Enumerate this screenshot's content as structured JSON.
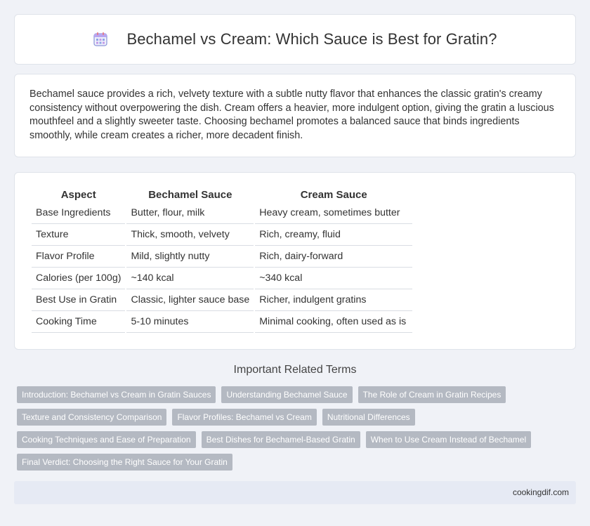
{
  "header": {
    "icon": "calendar-icon",
    "title": "Bechamel vs Cream: Which Sauce is Best for Gratin?"
  },
  "intro": {
    "text": "Bechamel sauce provides a rich, velvety texture with a subtle nutty flavor that enhances the classic gratin's creamy consistency without overpowering the dish. Cream offers a heavier, more indulgent option, giving the gratin a luscious mouthfeel and a slightly sweeter taste. Choosing bechamel promotes a balanced sauce that binds ingredients smoothly, while cream creates a richer, more decadent finish."
  },
  "table": {
    "headers": [
      "Aspect",
      "Bechamel Sauce",
      "Cream Sauce"
    ],
    "rows": [
      [
        "Base Ingredients",
        "Butter, flour, milk",
        "Heavy cream, sometimes butter"
      ],
      [
        "Texture",
        "Thick, smooth, velvety",
        "Rich, creamy, fluid"
      ],
      [
        "Flavor Profile",
        "Mild, slightly nutty",
        "Rich, dairy-forward"
      ],
      [
        "Calories (per 100g)",
        "~140 kcal",
        "~340 kcal"
      ],
      [
        "Best Use in Gratin",
        "Classic, lighter sauce base",
        "Richer, indulgent gratins"
      ],
      [
        "Cooking Time",
        "5-10 minutes",
        "Minimal cooking, often used as is"
      ]
    ]
  },
  "related": {
    "title": "Important Related Terms",
    "tags": [
      [
        "Introduction: Bechamel vs Cream in Gratin Sauces",
        "Understanding Bechamel Sauce",
        "The Role of Cream in Gratin Recipes"
      ],
      [
        "Texture and Consistency Comparison",
        "Flavor Profiles: Bechamel vs Cream",
        "Nutritional Differences"
      ],
      [
        "Cooking Techniques and Ease of Preparation",
        "Best Dishes for Bechamel-Based Gratin",
        "When to Use Cream Instead of Bechamel"
      ],
      [
        "Final Verdict: Choosing the Right Sauce for Your Gratin"
      ]
    ]
  },
  "footer": {
    "site": "cookingdif.com"
  },
  "colors": {
    "background": "#f0f2f7",
    "tag_bg": "#b4b9c2",
    "footer_bg": "#e6eaf4"
  }
}
